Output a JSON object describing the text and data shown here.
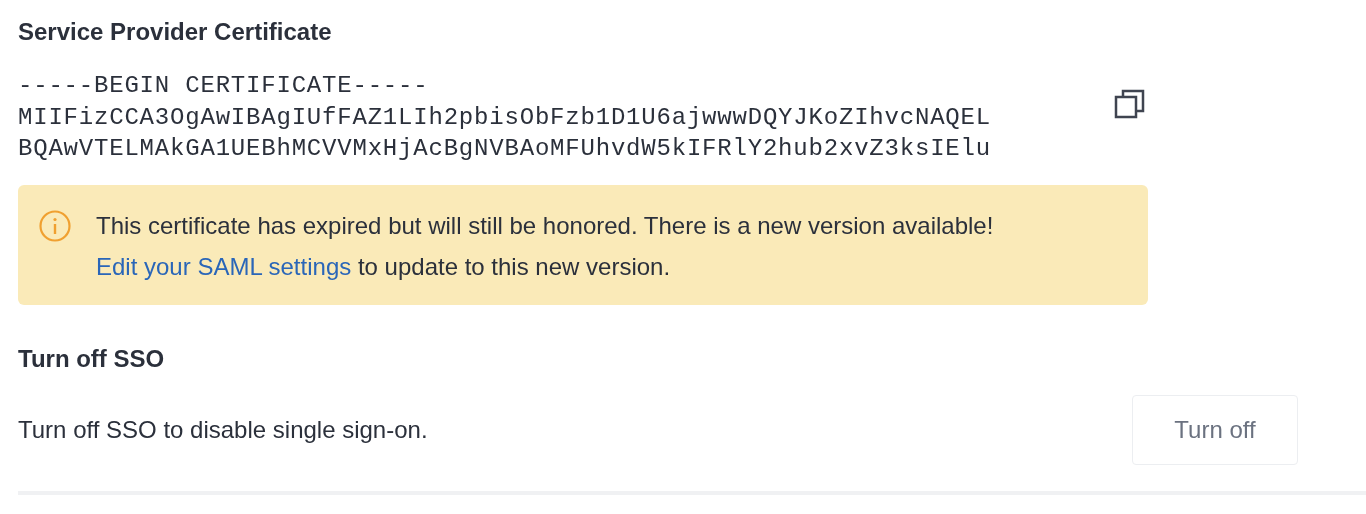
{
  "certificate": {
    "title": "Service Provider Certificate",
    "lines": [
      "-----BEGIN CERTIFICATE-----",
      "MIIFizCCA3OgAwIBAgIUfFAZ1LIh2pbisObFzb1D1U6ajwwwDQYJKoZIhvcNAQEL",
      "BQAwVTELMAkGA1UEBhMCVVMxHjAcBgNVBAoMFUhvdW5kIFRlY2hub2xvZ3ksIElu"
    ]
  },
  "alert": {
    "before": "This certificate has expired but will still be honored. There is a new version available!",
    "link": "Edit your SAML settings",
    "after": "to update to this new version."
  },
  "turn_off": {
    "title": "Turn off SSO",
    "description": "Turn off SSO to disable single sign-on.",
    "button": "Turn off"
  }
}
